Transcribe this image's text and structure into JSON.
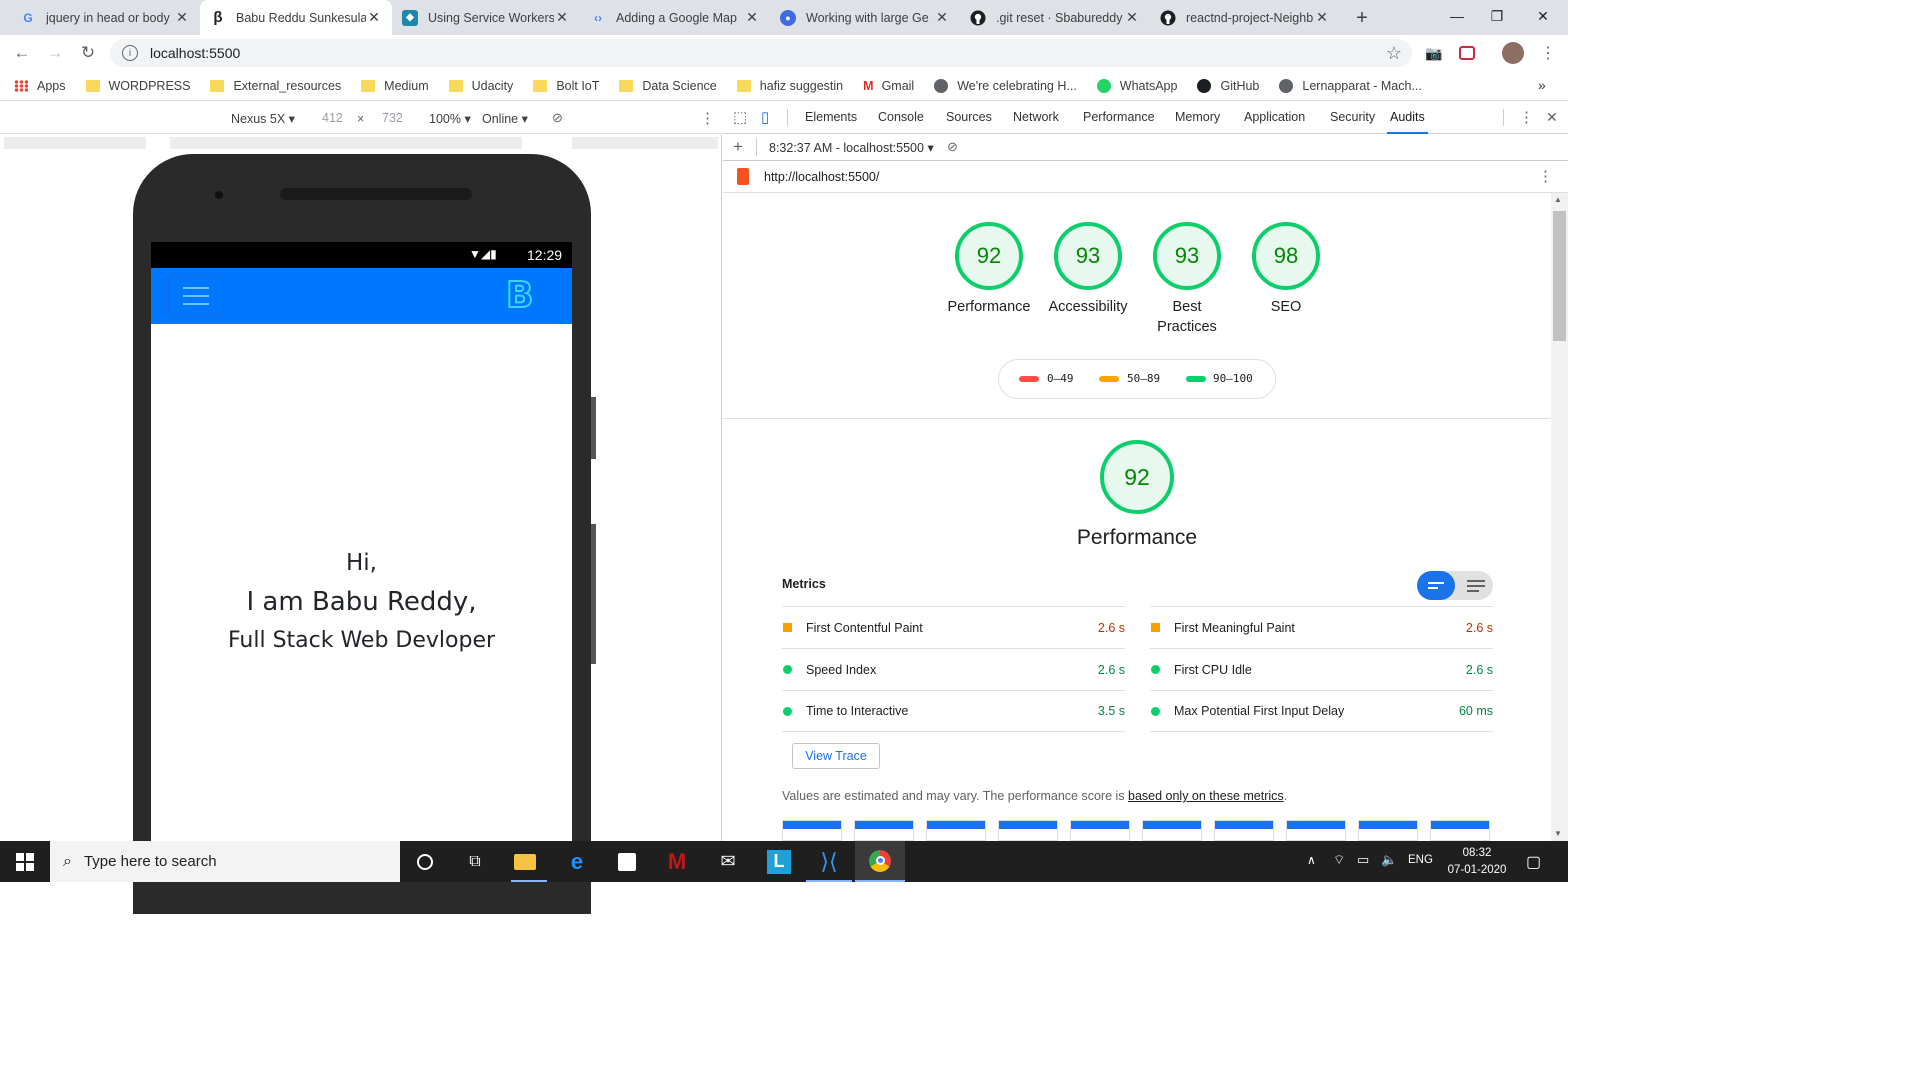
{
  "tabs": [
    {
      "title": "jquery in head or body",
      "icon": "google-icon"
    },
    {
      "title": "Babu Reddu Sunkesula",
      "icon": "beta-icon"
    },
    {
      "title": "Using Service Workers",
      "icon": "mdn-icon"
    },
    {
      "title": "Adding a Google Map",
      "icon": "google-dev-icon"
    },
    {
      "title": "Working with large Ge",
      "icon": "blue-circle-icon"
    },
    {
      "title": ".git reset · Sbabureddy",
      "icon": "github-icon"
    },
    {
      "title": "reactnd-project-Neighb",
      "icon": "github-icon"
    }
  ],
  "address": "localhost:5500",
  "bookmarks": [
    "Apps",
    "WORDPRESS",
    "External_resources",
    "Medium",
    "Udacity",
    "Bolt IoT",
    "Data Science",
    "hafiz suggestin",
    "Gmail",
    "We're celebrating H...",
    "WhatsApp",
    "GitHub",
    "Lernapparat - Mach..."
  ],
  "device_toolbar": {
    "device": "Nexus 5X",
    "width": "412",
    "x": "×",
    "height": "732",
    "zoom": "100%",
    "network": "Online"
  },
  "phone": {
    "time": "12:29",
    "greeting": "Hi,",
    "name": "I am Babu Reddy,",
    "role": "Full Stack Web Devloper",
    "logo_letter": "B"
  },
  "devtools": {
    "tabs": [
      "Elements",
      "Console",
      "Sources",
      "Network",
      "Performance",
      "Memory",
      "Application",
      "Security",
      "Audits"
    ],
    "active_tab": "Audits",
    "session": "8:32:37 AM - localhost:5500",
    "url": "http://localhost:5500/"
  },
  "scores": [
    {
      "value": "92",
      "label": "Performance"
    },
    {
      "value": "93",
      "label": "Accessibility"
    },
    {
      "value": "93",
      "label": "Best Practices"
    },
    {
      "value": "98",
      "label": "SEO"
    }
  ],
  "legend": [
    {
      "range": "0–49",
      "color": "#ff4e42"
    },
    {
      "range": "50–89",
      "color": "#ffa400"
    },
    {
      "range": "90–100",
      "color": "#0cce6b"
    }
  ],
  "performance": {
    "score": "92",
    "title": "Performance"
  },
  "metrics_title": "Metrics",
  "metrics": [
    {
      "name": "First Contentful Paint",
      "value": "2.6 s",
      "status": "average"
    },
    {
      "name": "First Meaningful Paint",
      "value": "2.6 s",
      "status": "average"
    },
    {
      "name": "Speed Index",
      "value": "2.6 s",
      "status": "pass"
    },
    {
      "name": "First CPU Idle",
      "value": "2.6 s",
      "status": "pass"
    },
    {
      "name": "Time to Interactive",
      "value": "3.5 s",
      "status": "pass"
    },
    {
      "name": "Max Potential First Input Delay",
      "value": "60 ms",
      "status": "pass"
    }
  ],
  "view_trace": "View Trace",
  "disclaimer": "Values are estimated and may vary. The performance score is ",
  "disclaimer_link": "based only on these metrics",
  "disclaimer_end": ".",
  "taskbar": {
    "search_placeholder": "Type here to search",
    "lang": "ENG",
    "time": "08:32",
    "date": "07-01-2020"
  },
  "colors": {
    "accent": "#1a73e8",
    "pass": "#0cce6b",
    "average": "#ffa400",
    "fail": "#ff4e42",
    "phone_header": "#0077ff"
  }
}
